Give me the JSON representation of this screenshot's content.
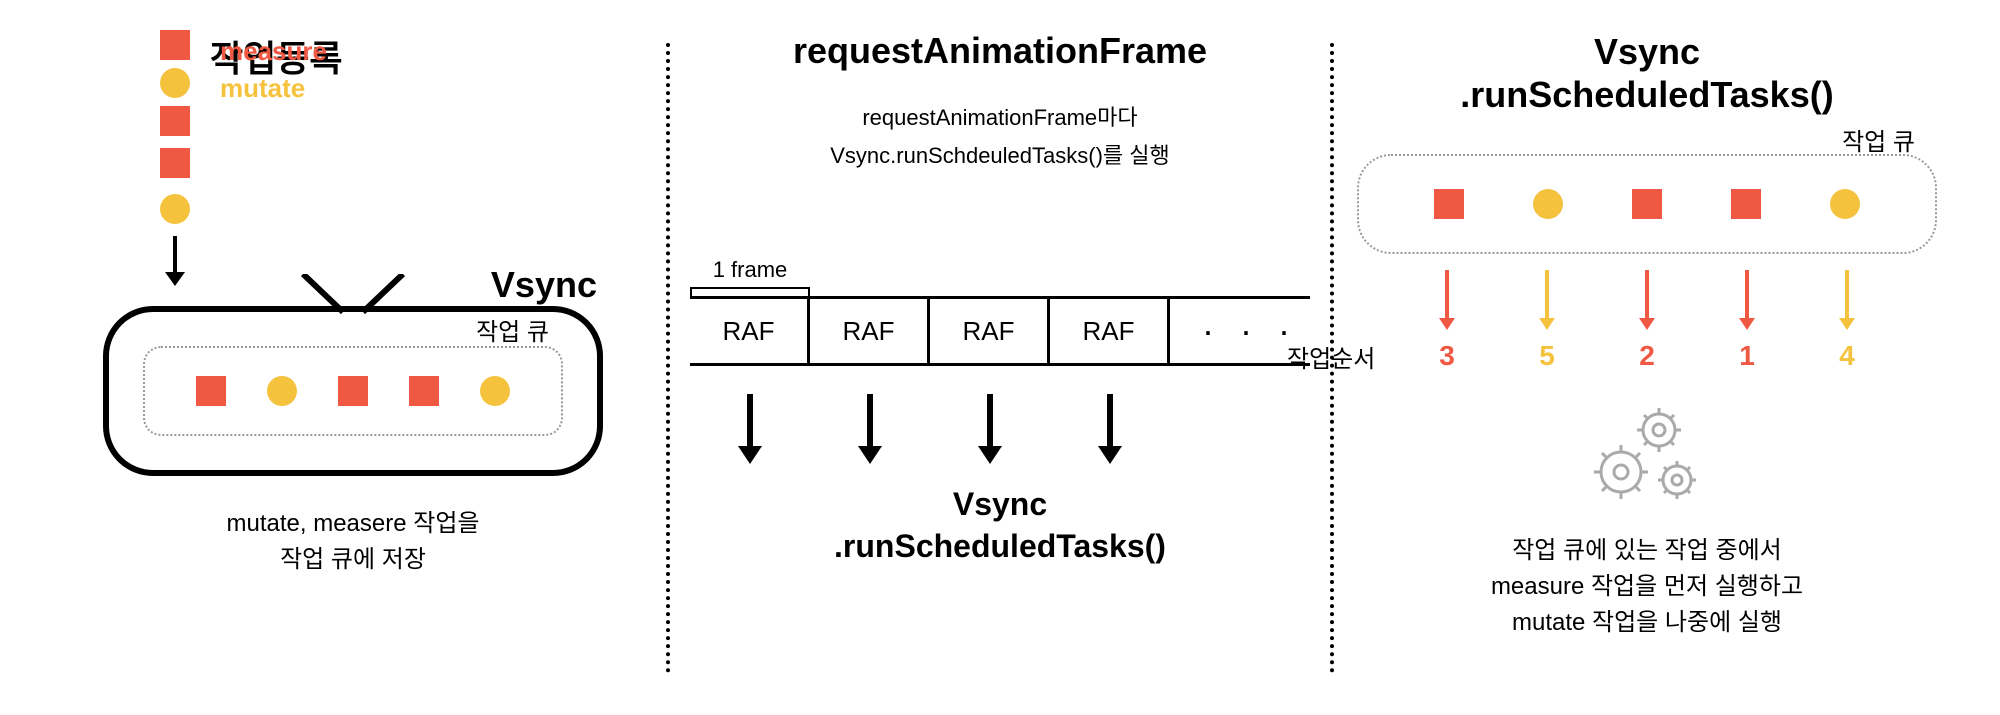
{
  "panel1": {
    "title": "작업등록",
    "legend_measure": "measure",
    "legend_mutate": "mutate",
    "vsync_label": "Vsync",
    "queue_label": "작업 큐",
    "caption_line1": "mutate, measere 작업을",
    "caption_line2": "작업 큐에 저장"
  },
  "panel2": {
    "title": "requestAnimationFrame",
    "sub_line1": "requestAnimationFrame마다",
    "sub_line2": "Vsync.runSchdeuledTasks()를 실행",
    "frame_label": "1 frame",
    "raf": "RAF",
    "ellipsis": "· · ·",
    "bottom_line1": "Vsync",
    "bottom_line2": ".runScheduledTasks()"
  },
  "panel3": {
    "title_line1": "Vsync",
    "title_line2": ".runScheduledTasks()",
    "queue_label": "작업 큐",
    "order_label": "작업순서",
    "orders": [
      "3",
      "5",
      "2",
      "1",
      "4"
    ],
    "order_colors": [
      "orange",
      "yellow",
      "orange",
      "orange",
      "yellow"
    ],
    "shapes": [
      "sq",
      "ci",
      "sq",
      "sq",
      "ci"
    ],
    "caption_line1": "작업 큐에 있는 작업 중에서",
    "caption_line2": "measure 작업을 먼저 실행하고",
    "caption_line3": "mutate 작업을 나중에 실행"
  }
}
